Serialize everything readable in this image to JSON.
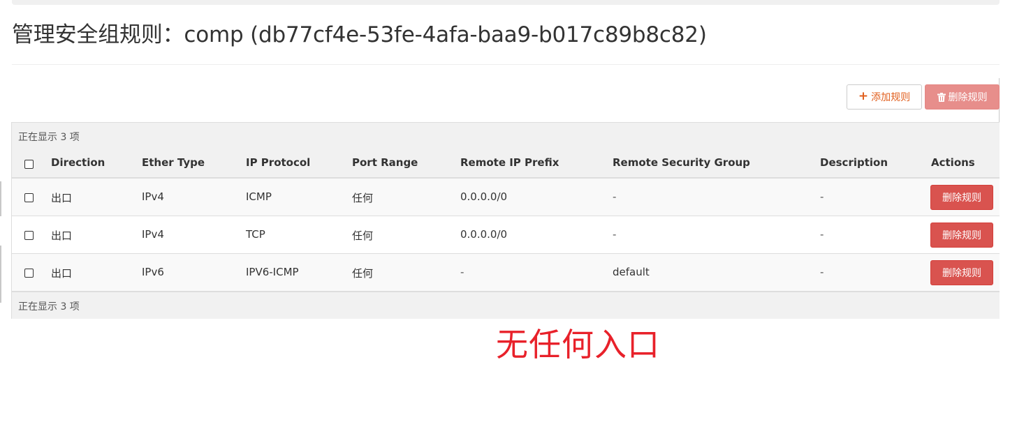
{
  "page": {
    "title": "管理安全组规则：comp (db77cf4e-53fe-4afa-baa9-b017c89b8c82)"
  },
  "toolbar": {
    "add_rule_label": "添加规则",
    "delete_rules_label": "删除规则",
    "add_icon": "plus-icon",
    "delete_icon": "trash-icon"
  },
  "table": {
    "count_top": "正在显示 3 项",
    "count_bottom": "正在显示 3 项",
    "columns": {
      "direction": "Direction",
      "ether_type": "Ether Type",
      "ip_protocol": "IP Protocol",
      "port_range": "Port Range",
      "remote_ip_prefix": "Remote IP Prefix",
      "remote_security_group": "Remote Security Group",
      "description": "Description",
      "actions": "Actions"
    },
    "rows": [
      {
        "direction": "出口",
        "ether_type": "IPv4",
        "ip_protocol": "ICMP",
        "port_range": "任何",
        "remote_ip_prefix": "0.0.0.0/0",
        "remote_security_group": "-",
        "description": "-",
        "action": "删除规则"
      },
      {
        "direction": "出口",
        "ether_type": "IPv4",
        "ip_protocol": "TCP",
        "port_range": "任何",
        "remote_ip_prefix": "0.0.0.0/0",
        "remote_security_group": "-",
        "description": "-",
        "action": "删除规则"
      },
      {
        "direction": "出口",
        "ether_type": "IPv6",
        "ip_protocol": "IPV6-ICMP",
        "port_range": "任何",
        "remote_ip_prefix": "-",
        "remote_security_group": "default",
        "description": "-",
        "action": "删除规则"
      }
    ]
  },
  "annotation": {
    "text": "无任何入口"
  },
  "colors": {
    "danger": "#d9534f",
    "danger_disabled": "#e78e8b",
    "add_accent": "#e15f1e",
    "annotation": "#e8212a"
  }
}
